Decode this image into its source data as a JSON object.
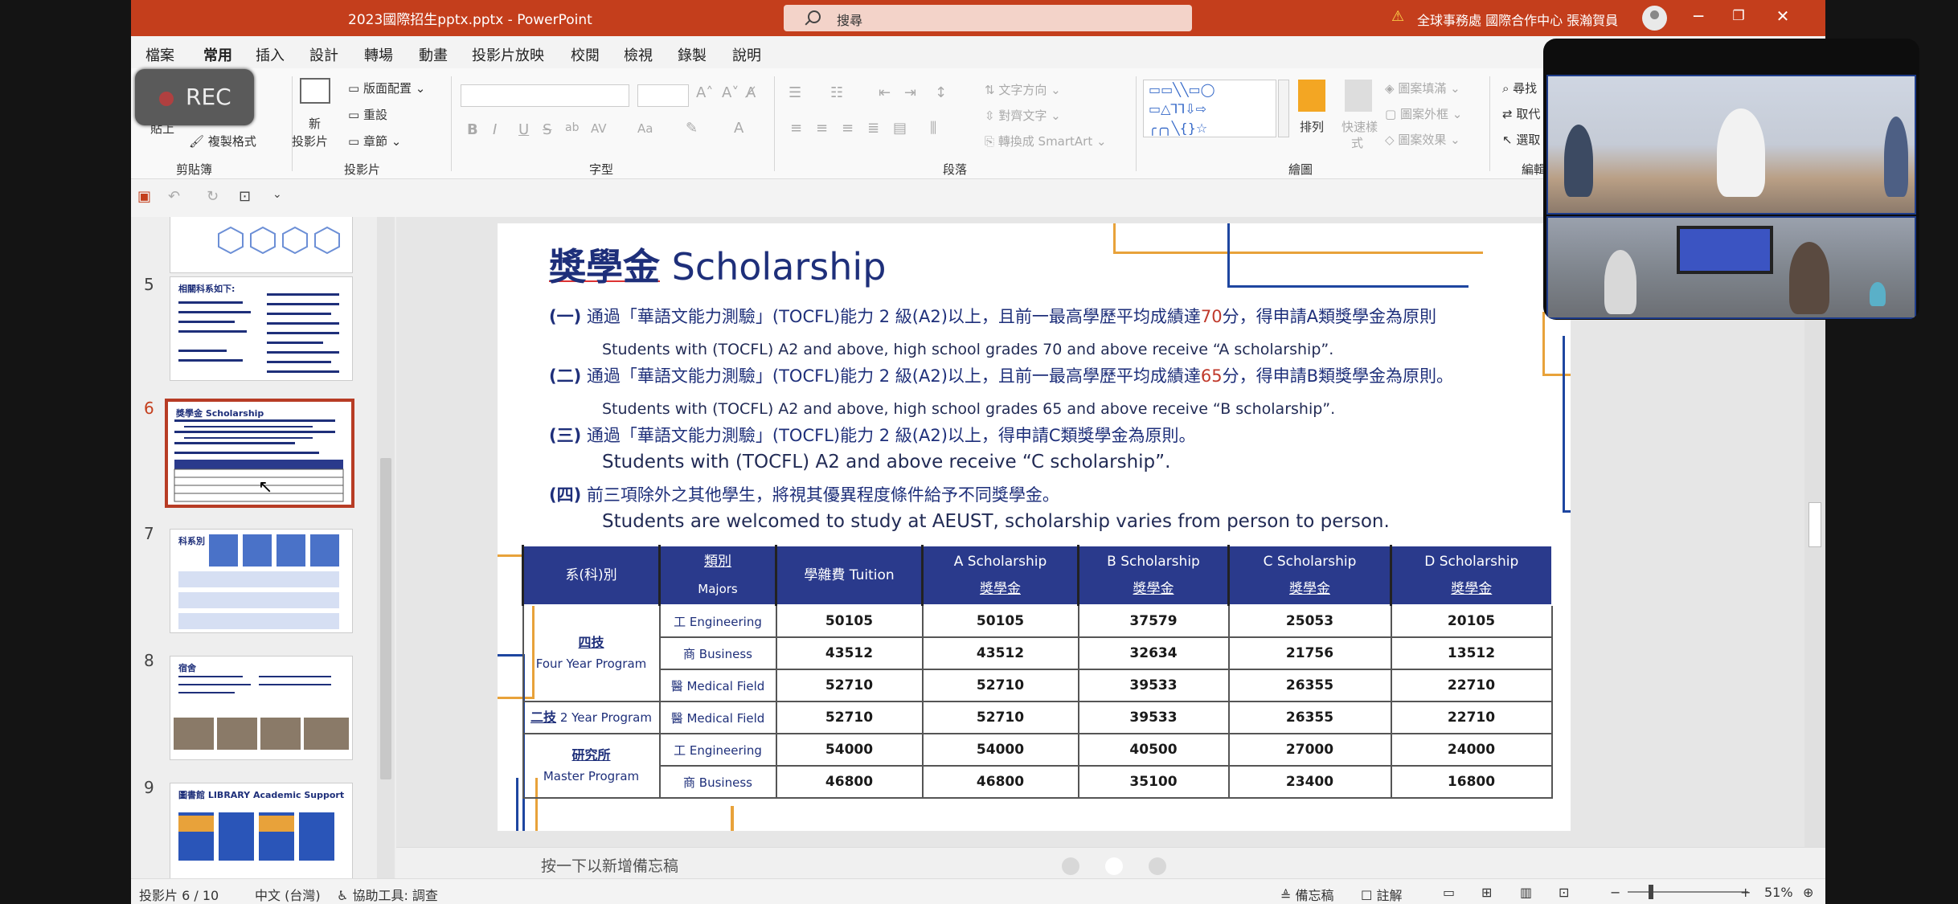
{
  "window": {
    "doc_title": "2023國際招生pptx.pptx  -  PowerPoint",
    "search_placeholder": "搜尋",
    "user": "全球事務處 國際合作中心 張瀚賀員",
    "minimize": "─",
    "restore": "❐",
    "close": "✕"
  },
  "menu": {
    "tabs": [
      "檔案",
      "常用",
      "插入",
      "設計",
      "轉場",
      "動畫",
      "投影片放映",
      "校閱",
      "檢視",
      "錄製",
      "說明"
    ],
    "active": "常用"
  },
  "rec": {
    "label": "REC"
  },
  "ribbon": {
    "clipboard": {
      "label": "剪貼簿",
      "paste_partial": "貼上",
      "format_painter": "複製格式"
    },
    "slides": {
      "label": "投影片",
      "new_slide": "新",
      "new_slide_2": "投影片",
      "layout": "版面配置",
      "reset": "重設",
      "section": "章節"
    },
    "font": {
      "label": "字型",
      "buttons": [
        "B",
        "I",
        "U",
        "S",
        "ab",
        "AV",
        "Aa"
      ]
    },
    "paragraph": {
      "label": "段落",
      "text_direction": "文字方向",
      "align_text": "對齊文字",
      "smartart": "轉換成 SmartArt"
    },
    "drawing": {
      "label": "繪圖",
      "arrange": "排列",
      "quick_styles": "快速樣",
      "quick_styles_2": "式",
      "fill": "圖案填滿",
      "outline": "圖案外框",
      "effects": "圖案效果"
    },
    "editing": {
      "label": "編輯",
      "find": "尋找",
      "replace": "取代",
      "select": "選取"
    }
  },
  "thumbnails": [
    {
      "number": "5",
      "title": "相關科系如下:"
    },
    {
      "number": "6",
      "title": "獎學金 Scholarship",
      "current": true
    },
    {
      "number": "7",
      "title": "科系別"
    },
    {
      "number": "8",
      "title": "宿舍"
    },
    {
      "number": "9",
      "title": "圖書館 LIBRARY Academic Support"
    }
  ],
  "slide": {
    "title_zh": "獎學金",
    "title_en": "Scholarship",
    "items": [
      {
        "num": "(一)",
        "zh_a": "通過「華語文能力測驗」(TOCFL)能力 2 級(A2)以上，且前一最高學歷平均成績達",
        "score": "70",
        "zh_b": "分，得申請A類獎學金為原則",
        "en": "Students with (TOCFL) A2 and above,  high school grades 70 and above receive “A scholarship”."
      },
      {
        "num": "(二)",
        "zh_a": "通過「華語文能力測驗」(TOCFL)能力 2 級(A2)以上，且前一最高學歷平均成績達",
        "score": "65",
        "zh_b": "分，得申請B類獎學金為原則。",
        "en": "Students with (TOCFL) A2 and above,  high school grades 65 and above receive “B scholarship”."
      },
      {
        "num": "(三)",
        "zh_a": "通過「華語文能力測驗」(TOCFL)能力 2 級(A2)以上，得申請C類獎學金為原則。",
        "score": "",
        "zh_b": "",
        "en": "Students with (TOCFL) A2 and above receive  “C scholarship”."
      },
      {
        "num": "(四)",
        "zh_a": "前三項除外之其他學生，將視其優異程度條件給予不同獎學金。",
        "score": "",
        "zh_b": "",
        "en": "Students are welcomed to study at AEUST, scholarship varies from person to person."
      }
    ],
    "table": {
      "headers": [
        {
          "l1": "系(科)別",
          "l2": ""
        },
        {
          "l1": "類別",
          "l2": "Majors"
        },
        {
          "l1": "學雜費 Tuition",
          "l2": ""
        },
        {
          "l1": "A  Scholarship",
          "l2": "獎學金"
        },
        {
          "l1": "B  Scholarship",
          "l2": "獎學金"
        },
        {
          "l1": "C  Scholarship",
          "l2": "獎學金"
        },
        {
          "l1": "D  Scholarship",
          "l2": "獎學金"
        }
      ],
      "programs": [
        {
          "zh": "四技",
          "en": "Four Year Program"
        },
        {
          "zh": "二技",
          "en": "2 Year Program"
        },
        {
          "zh": "研究所",
          "en": "Master Program"
        }
      ],
      "rows": [
        {
          "major": "工 Engineering",
          "values": [
            "50105",
            "50105",
            "37579",
            "25053",
            "20105"
          ]
        },
        {
          "major": "商 Business",
          "values": [
            "43512",
            "43512",
            "32634",
            "21756",
            "13512"
          ]
        },
        {
          "major": "醫 Medical Field",
          "values": [
            "52710",
            "52710",
            "39533",
            "26355",
            "22710"
          ]
        },
        {
          "major": "醫 Medical Field",
          "values": [
            "52710",
            "52710",
            "39533",
            "26355",
            "22710"
          ]
        },
        {
          "major": "工 Engineering",
          "values": [
            "54000",
            "54000",
            "40500",
            "27000",
            "24000"
          ]
        },
        {
          "major": "商 Business",
          "values": [
            "46800",
            "46800",
            "35100",
            "23400",
            "16800"
          ]
        }
      ]
    }
  },
  "notes": {
    "placeholder": "按一下以新增備忘稿"
  },
  "status": {
    "slide_count": "投影片 6 / 10",
    "language": "中文 (台灣)",
    "accessibility": "協助工具: 調查",
    "notes_btn": "備忘稿",
    "comments_btn": "註解",
    "zoom": "51%"
  },
  "colors": {
    "accent": "#c43e1c",
    "table_header": "#2a3a8c",
    "slide_text": "#1e2f7a",
    "highlight": "#c0392b"
  }
}
